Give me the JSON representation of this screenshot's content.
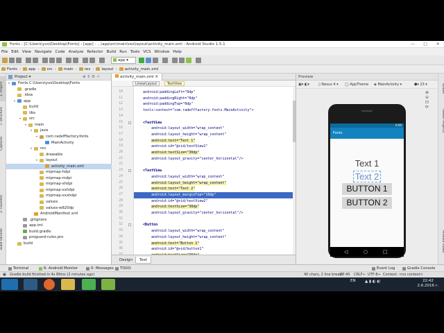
{
  "window": {
    "title": "Fonts - [C:\\Users\\yvo\\Desktop\\Fonts] - [app] - ...\\app\\src\\main\\res\\layout\\activity_main.xml - Android Studio 1.5.1"
  },
  "menu": [
    "File",
    "Edit",
    "View",
    "Navigate",
    "Code",
    "Analyze",
    "Refactor",
    "Build",
    "Run",
    "Tools",
    "VCS",
    "Window",
    "Help"
  ],
  "toolbar": {
    "run_config": "app"
  },
  "breadcrumbs": [
    "Fonts",
    "app",
    "src",
    "main",
    "res",
    "layout",
    "activity_main.xml"
  ],
  "side_tabs_left": [
    "1: Project",
    "7: Structure",
    "Captures",
    "2: Favorites",
    "Build Variants"
  ],
  "side_tabs_right": [
    "Gradle",
    "Maven Projects",
    "Android Model"
  ],
  "project": {
    "view_label": "Project",
    "tree": [
      {
        "label": "Fonts  C:\\Users\\yvo\\Desktop\\Fonts",
        "depth": 0,
        "icon": "module"
      },
      {
        "label": ".gradle",
        "depth": 1,
        "icon": "folder"
      },
      {
        "label": ".idea",
        "depth": 1,
        "icon": "folder"
      },
      {
        "label": "app",
        "depth": 1,
        "icon": "module"
      },
      {
        "label": "build",
        "depth": 2,
        "icon": "folder"
      },
      {
        "label": "libs",
        "depth": 2,
        "icon": "folder"
      },
      {
        "label": "src",
        "depth": 2,
        "icon": "folder"
      },
      {
        "label": "main",
        "depth": 3,
        "icon": "folder"
      },
      {
        "label": "java",
        "depth": 4,
        "icon": "folder"
      },
      {
        "label": "com.radefffactory.fonts",
        "depth": 5,
        "icon": "package"
      },
      {
        "label": "MainActivity",
        "depth": 6,
        "icon": "class"
      },
      {
        "label": "res",
        "depth": 4,
        "icon": "folder"
      },
      {
        "label": "drawable",
        "depth": 5,
        "icon": "folder"
      },
      {
        "label": "layout",
        "depth": 5,
        "icon": "folder"
      },
      {
        "label": "activity_main.xml",
        "depth": 6,
        "icon": "xml",
        "selected": true
      },
      {
        "label": "mipmap-hdpi",
        "depth": 5,
        "icon": "folder"
      },
      {
        "label": "mipmap-mdpi",
        "depth": 5,
        "icon": "folder"
      },
      {
        "label": "mipmap-xhdpi",
        "depth": 5,
        "icon": "folder"
      },
      {
        "label": "mipmap-xxhdpi",
        "depth": 5,
        "icon": "folder"
      },
      {
        "label": "mipmap-xxxhdpi",
        "depth": 5,
        "icon": "folder"
      },
      {
        "label": "values",
        "depth": 5,
        "icon": "folder"
      },
      {
        "label": "values-w820dp",
        "depth": 5,
        "icon": "folder"
      },
      {
        "label": "AndroidManifest.xml",
        "depth": 4,
        "icon": "xml"
      },
      {
        "label": ".gitignore",
        "depth": 2,
        "icon": "file"
      },
      {
        "label": "app.iml",
        "depth": 2,
        "icon": "file"
      },
      {
        "label": "build.gradle",
        "depth": 2,
        "icon": "gradle"
      },
      {
        "label": "proguard-rules.pro",
        "depth": 2,
        "icon": "file"
      },
      {
        "label": "build",
        "depth": 1,
        "icon": "folder"
      }
    ]
  },
  "editor": {
    "tab": "activity_main.xml",
    "crumb_tags": [
      "LinearLayout",
      "TextView"
    ],
    "lines": [
      {
        "n": "10",
        "text": "    android:paddingLeft=\"0dp\""
      },
      {
        "n": "11",
        "text": "    android:paddingRight=\"0dp\""
      },
      {
        "n": "12",
        "text": "    android:paddingTop=\"0dp\""
      },
      {
        "n": "13",
        "text": "    tools:context=\"com.radefffactory.fonts.MainActivity\">"
      },
      {
        "n": "14",
        "text": ""
      },
      {
        "n": "15",
        "text": "    <TextView"
      },
      {
        "n": "16",
        "text": "        android:layout_width=\"wrap_content\""
      },
      {
        "n": "17",
        "text": "        android:layout_height=\"wrap_content\""
      },
      {
        "n": "18",
        "text": "        android:text=\"Text 1\"",
        "hl": true
      },
      {
        "n": "19",
        "text": "        android:id=\"@+id/textView1\""
      },
      {
        "n": "20",
        "text": "        android:textSize=\"30dp\"",
        "hl": true
      },
      {
        "n": "21",
        "text": "        android:layout_gravity=\"center_horizontal\"/>"
      },
      {
        "n": "22",
        "text": ""
      },
      {
        "n": "23",
        "text": "    <TextView"
      },
      {
        "n": "24",
        "text": "        android:layout_width=\"wrap_content\""
      },
      {
        "n": "25",
        "text": "        android:layout_height=\"wrap_content\"",
        "hl": true
      },
      {
        "n": "26",
        "text": "        android:text=\"Text 2\"",
        "hl": true
      },
      {
        "n": "27",
        "text": "        android:layout_marginTop=\"10dp\"",
        "sel": true
      },
      {
        "n": "28",
        "text": "        android:id=\"@+id/textView2\""
      },
      {
        "n": "29",
        "text": "        android:textSize=\"30dp\"",
        "hl": true
      },
      {
        "n": "30",
        "text": "        android:layout_gravity=\"center_horizontal\"/>"
      },
      {
        "n": "31",
        "text": ""
      },
      {
        "n": "32",
        "text": "    <Button"
      },
      {
        "n": "33",
        "text": "        android:layout_width=\"wrap_content\""
      },
      {
        "n": "34",
        "text": "        android:layout_height=\"wrap_content\""
      },
      {
        "n": "35",
        "text": "        android:text=\"Button 1\"",
        "hl": true
      },
      {
        "n": "36",
        "text": "        android:id=\"@+id/button1\""
      },
      {
        "n": "37",
        "text": "        android:textSize=\"30dp\"",
        "hl": true
      },
      {
        "n": "38",
        "text": "        android:layout_gravity=\"center_horizontal\"/>"
      }
    ],
    "bottom_tabs": [
      "Design",
      "Text"
    ]
  },
  "preview": {
    "title": "Preview",
    "device": "Nexus 4",
    "theme": "AppTheme",
    "activity": "MainActivity",
    "api": "23",
    "app_title": "Fonts",
    "status_time": "6:00",
    "text1": "Text 1",
    "text2": "Text 2",
    "button1": "BUTTON 1",
    "button2": "BUTTON 2"
  },
  "tool_windows": {
    "left": [
      "Terminal",
      "6: Android Monitor",
      "0: Messages",
      "TODO"
    ],
    "right": [
      "Event Log",
      "Gradle Console"
    ]
  },
  "status": {
    "message": "Gradle build finished in 4s 89ms (2 minutes ago)",
    "chars": "40 chars, 2 line breaks",
    "pos": "27:40",
    "crlf": "CRLF÷",
    "enc": "UTF-8÷",
    "ctx": "Context: <no context>"
  },
  "taskbar": {
    "lang": "EN",
    "time": "22:42",
    "date": "2.6.2016 г."
  },
  "colors": {
    "selection": "#3d69c4",
    "highlight": "#f6f39a",
    "appbar": "#1283bf",
    "button": "#d6d6d6"
  }
}
